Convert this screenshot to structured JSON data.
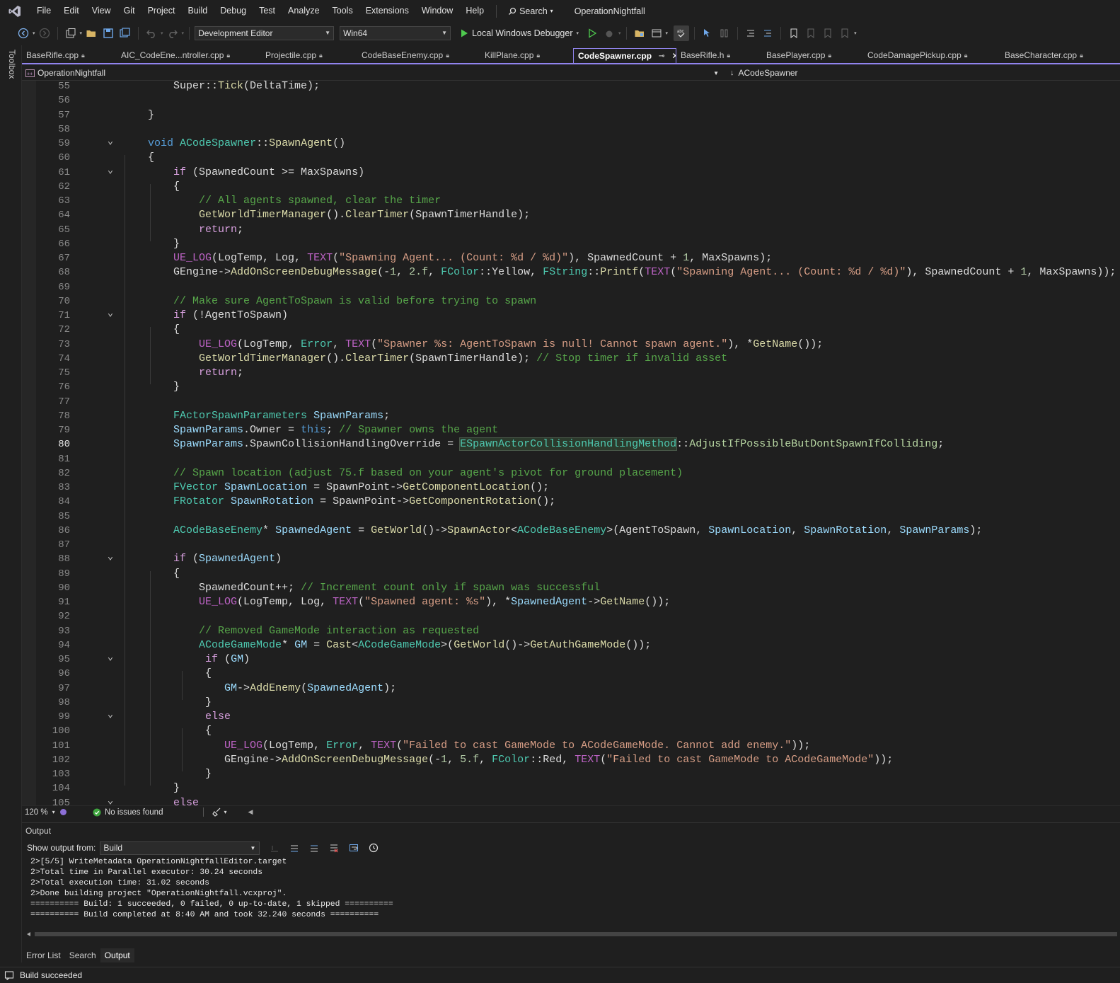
{
  "menu": {
    "items": [
      "File",
      "Edit",
      "View",
      "Git",
      "Project",
      "Build",
      "Debug",
      "Test",
      "Analyze",
      "Tools",
      "Extensions",
      "Window",
      "Help"
    ],
    "search_label": "Search",
    "solution_name": "OperationNightfall"
  },
  "toolbar": {
    "configuration": "Development Editor",
    "platform": "Win64",
    "debugger": "Local Windows Debugger"
  },
  "toolbox_label": "Toolbox",
  "tabs": [
    {
      "label": "BaseRifle.cpp",
      "active": false
    },
    {
      "label": "AIC_CodeEne...ntroller.cpp",
      "active": false
    },
    {
      "label": "Projectile.cpp",
      "active": false
    },
    {
      "label": "CodeBaseEnemy.cpp",
      "active": false
    },
    {
      "label": "KillPlane.cpp",
      "active": false
    },
    {
      "label": "CodeSpawner.cpp",
      "active": true
    },
    {
      "label": "BaseRifle.h",
      "active": false
    },
    {
      "label": "BasePlayer.cpp",
      "active": false
    },
    {
      "label": "CodeDamagePickup.cpp",
      "active": false
    },
    {
      "label": "BaseCharacter.cpp",
      "active": false
    }
  ],
  "navbar": {
    "project": "OperationNightfall",
    "member": "ACodeSpawner"
  },
  "editor": {
    "current_line": 80,
    "lines": [
      {
        "n": 55,
        "t": "        Super::Tick(DeltaTime);"
      },
      {
        "n": 56,
        "t": ""
      },
      {
        "n": 57,
        "t": "    }"
      },
      {
        "n": 58,
        "t": ""
      },
      {
        "n": 59,
        "t": "    void ACodeSpawner::SpawnAgent()"
      },
      {
        "n": 60,
        "t": "    {"
      },
      {
        "n": 61,
        "t": "        if (SpawnedCount >= MaxSpawns)"
      },
      {
        "n": 62,
        "t": "        {"
      },
      {
        "n": 63,
        "t": "            // All agents spawned, clear the timer"
      },
      {
        "n": 64,
        "t": "            GetWorldTimerManager().ClearTimer(SpawnTimerHandle);"
      },
      {
        "n": 65,
        "t": "            return;"
      },
      {
        "n": 66,
        "t": "        }"
      },
      {
        "n": 67,
        "t": "        UE_LOG(LogTemp, Log, TEXT(\"Spawning Agent... (Count: %d / %d)\"), SpawnedCount + 1, MaxSpawns);"
      },
      {
        "n": 68,
        "t": "        GEngine->AddOnScreenDebugMessage(-1, 2.f, FColor::Yellow, FString::Printf(TEXT(\"Spawning Agent... (Count: %d / %d)\"), SpawnedCount + 1, MaxSpawns));"
      },
      {
        "n": 69,
        "t": ""
      },
      {
        "n": 70,
        "t": "        // Make sure AgentToSpawn is valid before trying to spawn"
      },
      {
        "n": 71,
        "t": "        if (!AgentToSpawn)"
      },
      {
        "n": 72,
        "t": "        {"
      },
      {
        "n": 73,
        "t": "            UE_LOG(LogTemp, Error, TEXT(\"Spawner %s: AgentToSpawn is null! Cannot spawn agent.\"), *GetName());"
      },
      {
        "n": 74,
        "t": "            GetWorldTimerManager().ClearTimer(SpawnTimerHandle); // Stop timer if invalid asset"
      },
      {
        "n": 75,
        "t": "            return;"
      },
      {
        "n": 76,
        "t": "        }"
      },
      {
        "n": 77,
        "t": ""
      },
      {
        "n": 78,
        "t": "        FActorSpawnParameters SpawnParams;"
      },
      {
        "n": 79,
        "t": "        SpawnParams.Owner = this; // Spawner owns the agent"
      },
      {
        "n": 80,
        "t": "        SpawnParams.SpawnCollisionHandlingOverride = ESpawnActorCollisionHandlingMethod::AdjustIfPossibleButDontSpawnIfColliding;"
      },
      {
        "n": 81,
        "t": ""
      },
      {
        "n": 82,
        "t": "        // Spawn location (adjust 75.f based on your agent's pivot for ground placement)"
      },
      {
        "n": 83,
        "t": "        FVector SpawnLocation = SpawnPoint->GetComponentLocation();"
      },
      {
        "n": 84,
        "t": "        FRotator SpawnRotation = SpawnPoint->GetComponentRotation();"
      },
      {
        "n": 85,
        "t": ""
      },
      {
        "n": 86,
        "t": "        ACodeBaseEnemy* SpawnedAgent = GetWorld()->SpawnActor<ACodeBaseEnemy>(AgentToSpawn, SpawnLocation, SpawnRotation, SpawnParams);"
      },
      {
        "n": 87,
        "t": ""
      },
      {
        "n": 88,
        "t": "        if (SpawnedAgent)"
      },
      {
        "n": 89,
        "t": "        {"
      },
      {
        "n": 90,
        "t": "            SpawnedCount++; // Increment count only if spawn was successful"
      },
      {
        "n": 91,
        "t": "            UE_LOG(LogTemp, Log, TEXT(\"Spawned agent: %s\"), *SpawnedAgent->GetName());"
      },
      {
        "n": 92,
        "t": ""
      },
      {
        "n": 93,
        "t": "            // Removed GameMode interaction as requested"
      },
      {
        "n": 94,
        "t": "            ACodeGameMode* GM = Cast<ACodeGameMode>(GetWorld()->GetAuthGameMode());"
      },
      {
        "n": 95,
        "t": "             if (GM)"
      },
      {
        "n": 96,
        "t": "             {"
      },
      {
        "n": 97,
        "t": "                GM->AddEnemy(SpawnedAgent);"
      },
      {
        "n": 98,
        "t": "             }"
      },
      {
        "n": 99,
        "t": "             else"
      },
      {
        "n": 100,
        "t": "             {"
      },
      {
        "n": 101,
        "t": "                UE_LOG(LogTemp, Error, TEXT(\"Failed to cast GameMode to ACodeGameMode. Cannot add enemy.\"));"
      },
      {
        "n": 102,
        "t": "                GEngine->AddOnScreenDebugMessage(-1, 5.f, FColor::Red, TEXT(\"Failed to cast GameMode to ACodeGameMode\"));"
      },
      {
        "n": 103,
        "t": "             }"
      },
      {
        "n": 104,
        "t": "        }"
      },
      {
        "n": 105,
        "t": "        else"
      }
    ],
    "folds": [
      59,
      61,
      71,
      88,
      95,
      99,
      105
    ]
  },
  "editor_status": {
    "zoom": "120 %",
    "issues": "No issues found"
  },
  "output": {
    "title": "Output",
    "show_from_label": "Show output from:",
    "source": "Build",
    "lines": [
      "2>[5/5] WriteMetadata OperationNightfallEditor.target",
      "2>Total time in Parallel executor: 30.24 seconds",
      "2>Total execution time: 31.02 seconds",
      "2>Done building project \"OperationNightfall.vcxproj\".",
      "========== Build: 1 succeeded, 0 failed, 0 up-to-date, 1 skipped ==========",
      "========== Build completed at 8:40 AM and took 32.240 seconds =========="
    ]
  },
  "bottom_tabs": [
    {
      "label": "Error List",
      "active": false
    },
    {
      "label": "Search",
      "active": false
    },
    {
      "label": "Output",
      "active": true
    }
  ],
  "status": {
    "message": "Build succeeded"
  }
}
